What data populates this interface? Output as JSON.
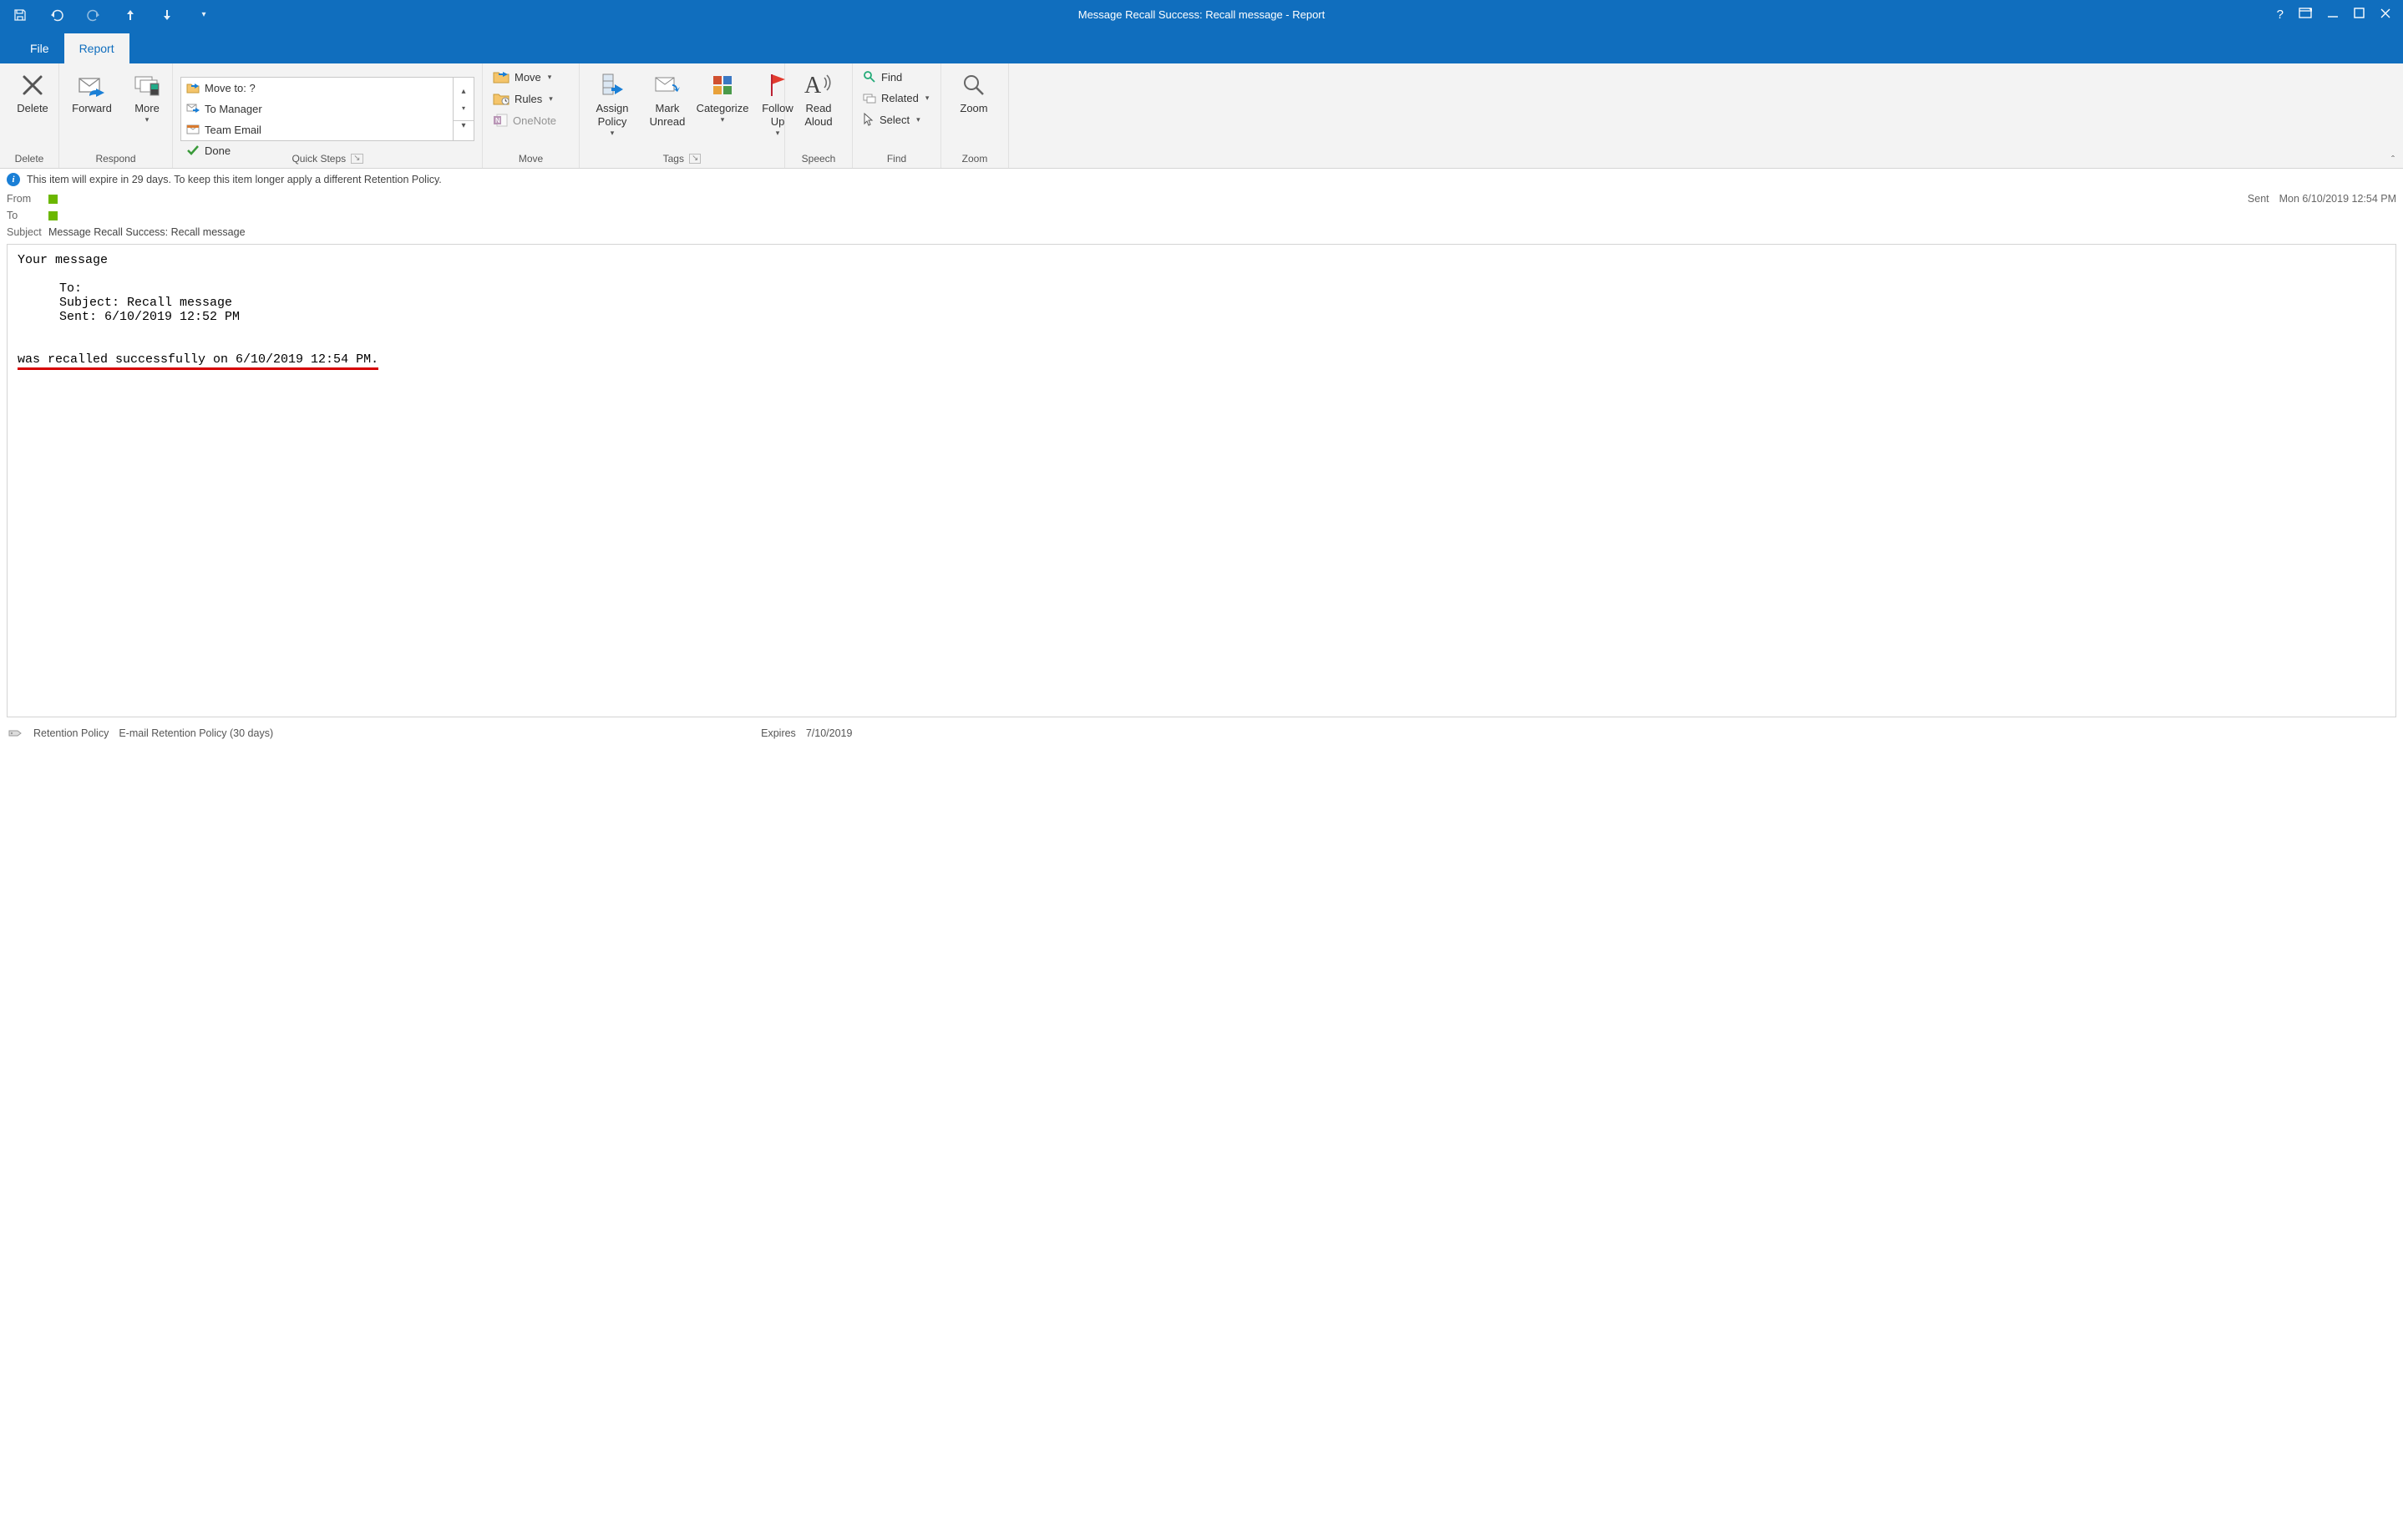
{
  "window": {
    "title": "Message Recall Success: Recall message  -  Report"
  },
  "tabs": {
    "file": "File",
    "report": "Report"
  },
  "ribbon": {
    "delete_group": {
      "delete": "Delete",
      "label": "Delete"
    },
    "respond_group": {
      "forward": "Forward",
      "more": "More",
      "label": "Respond"
    },
    "quicksteps": {
      "label": "Quick Steps",
      "moveto": "Move to: ?",
      "to_manager": "To Manager",
      "team_email": "Team Email",
      "done": "Done"
    },
    "move_group": {
      "move": "Move",
      "rules": "Rules",
      "onenote": "OneNote",
      "label": "Move"
    },
    "tags_group": {
      "assign_policy": "Assign Policy",
      "mark_unread": "Mark Unread",
      "categorize": "Categorize",
      "follow_up": "Follow Up",
      "label": "Tags"
    },
    "speech_group": {
      "read_aloud": "Read Aloud",
      "label": "Speech"
    },
    "find_group": {
      "find": "Find",
      "related": "Related",
      "select": "Select",
      "label": "Find"
    },
    "zoom_group": {
      "zoom": "Zoom",
      "label": "Zoom"
    }
  },
  "infobar": {
    "text": "This item will expire in 29 days. To keep this item longer apply a different Retention Policy."
  },
  "header": {
    "from_label": "From",
    "to_label": "To",
    "subject_label": "Subject",
    "subject_value": "Message Recall Success: Recall message",
    "sent_label": "Sent",
    "sent_value": "Mon 6/10/2019 12:54 PM"
  },
  "body": {
    "line1": "Your message",
    "to_line": "To:      ",
    "subject_line": "Subject:    Recall message",
    "sent_line": "Sent:  6/10/2019 12:52 PM",
    "result_line": "was recalled successfully on 6/10/2019 12:54 PM."
  },
  "status": {
    "retention_label": "Retention Policy",
    "retention_value": "E-mail Retention Policy (30 days)",
    "expires_label": "Expires",
    "expires_value": "7/10/2019"
  }
}
